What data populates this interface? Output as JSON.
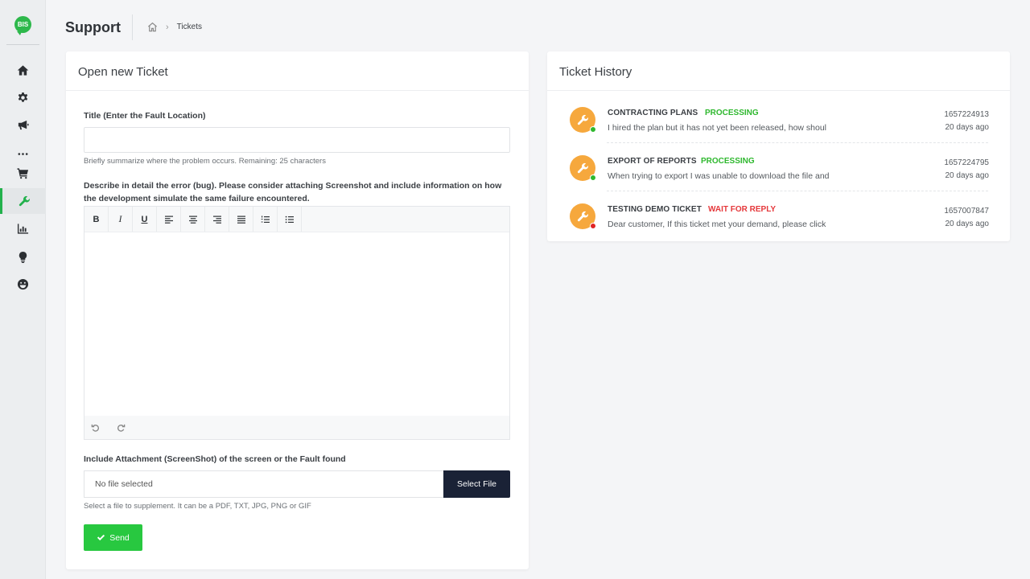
{
  "app": {
    "logo_text": "BIS"
  },
  "header": {
    "title": "Support",
    "breadcrumb_current": "Tickets"
  },
  "sidebar": {
    "items": [
      {
        "name": "home-icon"
      },
      {
        "name": "gear-icon"
      },
      {
        "name": "megaphone-icon"
      },
      {
        "name": "more-icon"
      },
      {
        "name": "cart-icon"
      },
      {
        "name": "wrench-icon",
        "active": true
      },
      {
        "name": "bar-chart-icon"
      },
      {
        "name": "lightbulb-icon"
      },
      {
        "name": "smiley-icon"
      }
    ]
  },
  "new_ticket": {
    "card_title": "Open new Ticket",
    "title_label": "Title (Enter the Fault Location)",
    "title_value": "",
    "title_help": "Briefly summarize where the problem occurs. Remaining: 25 characters",
    "desc_label": "Describe in detail the error (bug). Please consider attaching Screenshot and include information on how the development simulate the same failure encountered.",
    "toolbar": [
      "bold",
      "italic",
      "underline",
      "align-left",
      "align-center",
      "align-right",
      "justify",
      "ordered-list",
      "unordered-list"
    ],
    "attach_label": "Include Attachment (ScreenShot) of the screen or the Fault found",
    "file_placeholder": "No file selected",
    "file_button": "Select File",
    "attach_help": "Select a file to supplement. It can be a PDF, TXT, JPG, PNG or GIF",
    "send_label": "Send"
  },
  "history": {
    "card_title": "Ticket History",
    "tickets": [
      {
        "title": "CONTRACTING PLANS",
        "status": "PROCESSING",
        "status_color": "#2eb82e",
        "dot_color": "#2eb82e",
        "description": "I hired the plan but it has not yet been released, how shoul",
        "id": "1657224913",
        "time": "20 days ago"
      },
      {
        "title": "EXPORT OF REPORTS",
        "status": "PROCESSING",
        "status_color": "#2eb82e",
        "dot_color": "#2eb82e",
        "description": "When trying to export I was unable to download the file and",
        "id": "1657224795",
        "time": "20 days ago"
      },
      {
        "title": "TESTING DEMO TICKET",
        "status": "WAIT FOR REPLY",
        "status_color": "#e5383b",
        "dot_color": "#e02424",
        "description": "Dear customer, If this ticket met your demand, please click",
        "id": "1657007847",
        "time": "20 days ago"
      }
    ]
  },
  "colors": {
    "accent": "#22b14c",
    "dark_button": "#1a2236",
    "ticket_icon": "#f6a83d",
    "send": "#28c840"
  }
}
